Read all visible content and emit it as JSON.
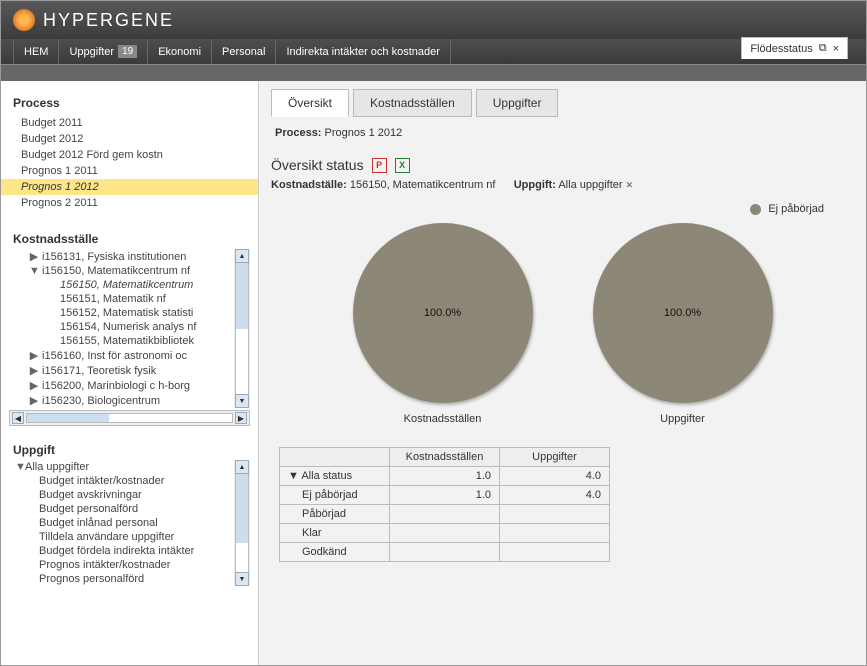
{
  "brand": "HYPERGENE",
  "nav": {
    "items": [
      {
        "label": "HEM"
      },
      {
        "label": "Uppgifter",
        "badge": "19"
      },
      {
        "label": "Ekonomi"
      },
      {
        "label": "Personal"
      },
      {
        "label": "Indirekta intäkter och kostnader"
      }
    ],
    "float_tab": {
      "label": "Flödesstatus",
      "close": "×"
    }
  },
  "sidebar": {
    "process": {
      "title": "Process",
      "items": [
        {
          "label": "Budget 2011"
        },
        {
          "label": "Budget 2012"
        },
        {
          "label": "Budget 2012 Förd gem kostn"
        },
        {
          "label": "Prognos 1 2011"
        },
        {
          "label": "Prognos 1 2012",
          "selected": true
        },
        {
          "label": "Prognos 2 2011"
        }
      ]
    },
    "kost": {
      "title": "Kostnadsställe",
      "tree": [
        {
          "ind": 0,
          "tw": "▶",
          "label": "i156131, Fysiska institutionen"
        },
        {
          "ind": 0,
          "tw": "▼",
          "label": "i156150, Matematikcentrum nf"
        },
        {
          "ind": 1,
          "tw": "",
          "label": "156150, Matematikcentrum",
          "selected": true
        },
        {
          "ind": 1,
          "tw": "",
          "label": "156151, Matematik nf"
        },
        {
          "ind": 1,
          "tw": "",
          "label": "156152, Matematisk statisti"
        },
        {
          "ind": 1,
          "tw": "",
          "label": "156154, Numerisk analys nf"
        },
        {
          "ind": 1,
          "tw": "",
          "label": "156155, Matematikbibliotek"
        },
        {
          "ind": 0,
          "tw": "▶",
          "label": "i156160, Inst för astronomi oc"
        },
        {
          "ind": 0,
          "tw": "▶",
          "label": "i156171, Teoretisk fysik"
        },
        {
          "ind": 0,
          "tw": "▶",
          "label": "i156200, Marinbiologi c h-borg"
        },
        {
          "ind": 0,
          "tw": "▶",
          "label": "i156230, Biologicentrum"
        }
      ]
    },
    "upp": {
      "title": "Uppgift",
      "items": [
        {
          "label": "Alla uppgifter",
          "tw": "▼"
        },
        {
          "label": "Budget intäkter/kostnader"
        },
        {
          "label": "Budget avskrivningar"
        },
        {
          "label": "Budget personalförd"
        },
        {
          "label": "Budget inlånad personal"
        },
        {
          "label": "Tilldela användare uppgifter"
        },
        {
          "label": "Budget fördela indirekta intäkter"
        },
        {
          "label": "Prognos intäkter/kostnader"
        },
        {
          "label": "Prognos personalförd"
        }
      ]
    }
  },
  "main": {
    "tabs": [
      {
        "label": "Översikt",
        "active": true
      },
      {
        "label": "Kostnadsställen"
      },
      {
        "label": "Uppgifter"
      }
    ],
    "process_label": "Process:",
    "process_value": "Prognos 1 2012",
    "ov_title": "Översikt status",
    "filter": {
      "k_label": "Kostnadställe:",
      "k_value": "156150, Matematikcentrum nf",
      "u_label": "Uppgift:",
      "u_value": "Alla uppgifter"
    },
    "legend": "Ej påbörjad",
    "pies": [
      {
        "label": "Kostnadsställen",
        "value": "100.0%"
      },
      {
        "label": "Uppgifter",
        "value": "100.0%"
      }
    ],
    "table": {
      "headers": [
        "",
        "Kostnadsställen",
        "Uppgifter"
      ],
      "rows": [
        {
          "label": "Alla status",
          "tw": "▼",
          "k": "1.0",
          "u": "4.0"
        },
        {
          "label": "Ej påbörjad",
          "k": "1.0",
          "u": "4.0"
        },
        {
          "label": "Påbörjad",
          "k": "",
          "u": ""
        },
        {
          "label": "Klar",
          "k": "",
          "u": ""
        },
        {
          "label": "Godkänd",
          "k": "",
          "u": ""
        }
      ]
    }
  },
  "chart_data": [
    {
      "type": "pie",
      "title": "Kostnadsställen",
      "series": [
        {
          "name": "Ej påbörjad",
          "value": 100.0
        }
      ]
    },
    {
      "type": "pie",
      "title": "Uppgifter",
      "series": [
        {
          "name": "Ej påbörjad",
          "value": 100.0
        }
      ]
    }
  ]
}
